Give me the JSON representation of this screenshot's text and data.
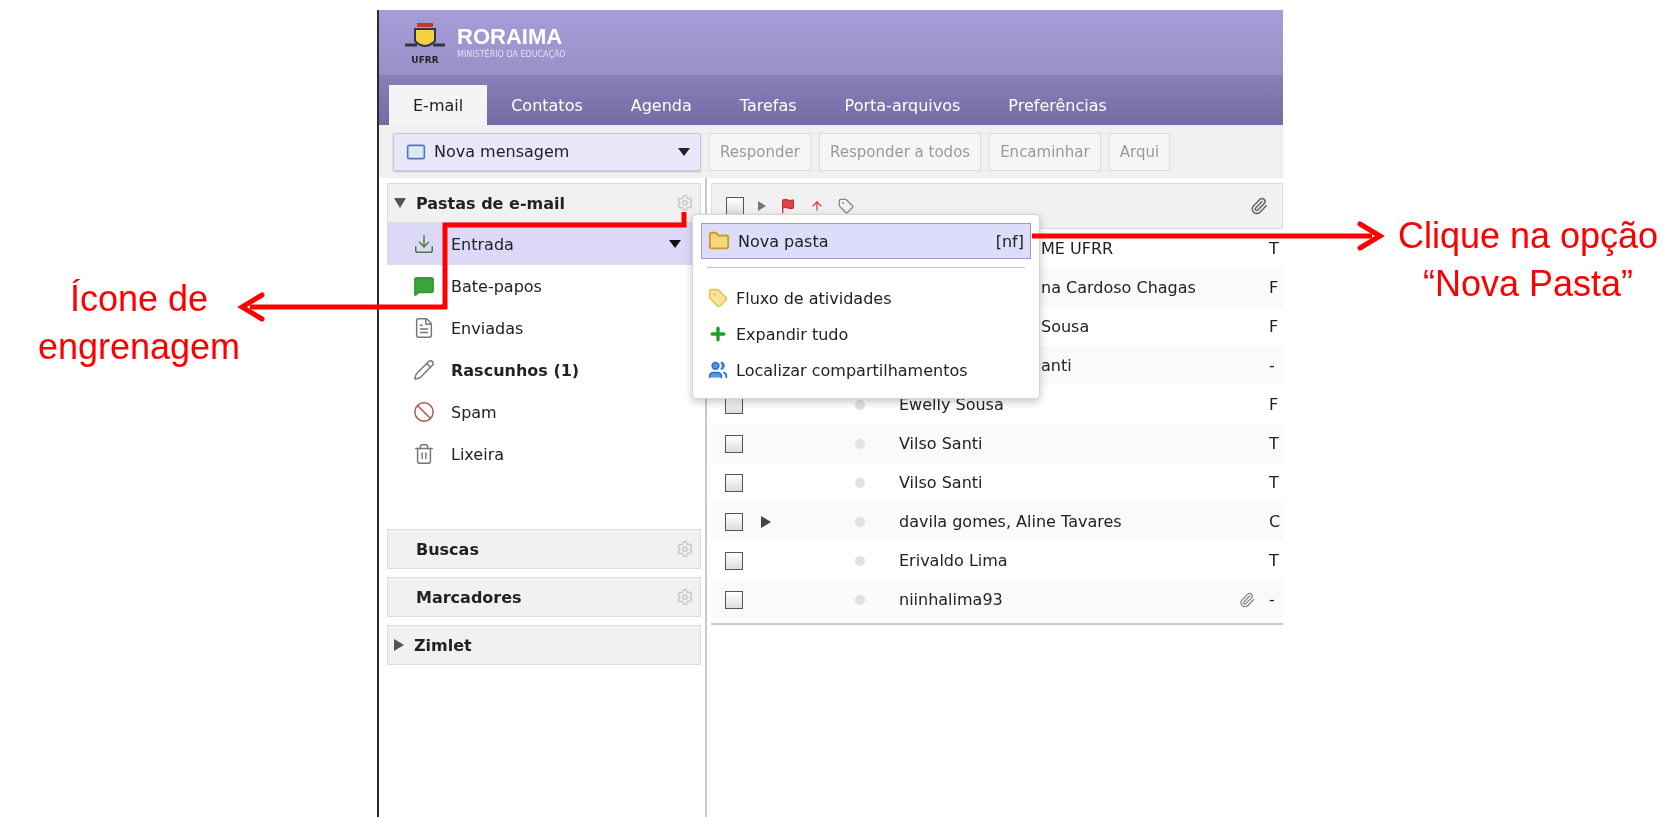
{
  "header": {
    "badge": "UFRR",
    "title": "RORAIMA",
    "subtitle": "MINISTÉRIO DA EDUCAÇÃO"
  },
  "tabs": [
    {
      "label": "E-mail",
      "selected": true
    },
    {
      "label": "Contatos",
      "selected": false
    },
    {
      "label": "Agenda",
      "selected": false
    },
    {
      "label": "Tarefas",
      "selected": false
    },
    {
      "label": "Porta-arquivos",
      "selected": false
    },
    {
      "label": "Preferências",
      "selected": false
    }
  ],
  "toolbar": {
    "new_button": "Nova mensagem",
    "buttons": [
      {
        "label": "Responder",
        "disabled": true
      },
      {
        "label": "Responder a todos",
        "disabled": true
      },
      {
        "label": "Encaminhar",
        "disabled": true
      },
      {
        "label": "Arqui",
        "disabled": true
      }
    ]
  },
  "sidebar": {
    "sections": [
      {
        "title": "Pastas de e-mail",
        "kind": "tree",
        "expanded": true,
        "gear": true,
        "items": [
          {
            "label": "Entrada",
            "kind": "inbox",
            "selected": true,
            "unread": false
          },
          {
            "label": "Bate-papos",
            "kind": "chats",
            "selected": false,
            "unread": false
          },
          {
            "label": "Enviadas",
            "kind": "sent",
            "selected": false,
            "unread": false
          },
          {
            "label": "Rascunhos (1)",
            "kind": "drafts",
            "selected": false,
            "unread": true
          },
          {
            "label": "Spam",
            "kind": "spam",
            "selected": false,
            "unread": false
          },
          {
            "label": "Lixeira",
            "kind": "trash",
            "selected": false,
            "unread": false
          }
        ]
      },
      {
        "title": "Buscas",
        "kind": "plain",
        "gear": true
      },
      {
        "title": "Marcadores",
        "kind": "plain",
        "gear": true
      },
      {
        "title": "Zimlet",
        "kind": "tree",
        "expanded": false,
        "gear": false
      }
    ]
  },
  "message_list": {
    "select_all_checked": false,
    "rows": [
      {
        "from": "ME UFRR",
        "column_2": "T",
        "covered": true,
        "thread": false,
        "attachment": false
      },
      {
        "from": "na Cardoso Chagas",
        "column_2": "F",
        "covered": true,
        "thread": false,
        "attachment": false
      },
      {
        "from": "Sousa",
        "column_2": "F",
        "covered": true,
        "thread": false,
        "attachment": false
      },
      {
        "from": "anti",
        "column_2": "-",
        "covered": true,
        "thread": false,
        "attachment": false
      },
      {
        "from": "Ewelly Sousa",
        "column_2": "F",
        "covered": false,
        "checked": false,
        "thread": false,
        "attachment": false
      },
      {
        "from": "Vilso Santi",
        "column_2": "T",
        "covered": false,
        "checked": false,
        "thread": false,
        "attachment": false
      },
      {
        "from": "Vilso Santi",
        "column_2": "T",
        "covered": false,
        "checked": false,
        "thread": false,
        "attachment": false
      },
      {
        "from": "davila gomes, Aline Tavares",
        "column_2": "C",
        "covered": false,
        "checked": false,
        "thread": true,
        "attachment": false
      },
      {
        "from": "Erivaldo Lima",
        "column_2": "T",
        "covered": false,
        "checked": false,
        "thread": false,
        "attachment": false
      },
      {
        "from": "niinhalima93",
        "column_2": "-",
        "covered": false,
        "checked": false,
        "thread": false,
        "attachment": true
      }
    ]
  },
  "context_menu": {
    "items": [
      {
        "kind": "new-folder",
        "label": "Nova pasta",
        "shortcut": "[nf]",
        "selected": true
      },
      {
        "kind": "separator"
      },
      {
        "kind": "activity",
        "label": "Fluxo de atividades",
        "selected": false
      },
      {
        "kind": "expand",
        "label": "Expandir tudo",
        "selected": false
      },
      {
        "kind": "shares",
        "label": "Localizar compartilhamentos",
        "selected": false
      }
    ]
  },
  "annotations": {
    "left": "Ícone de engrenagem",
    "right": "Clique na opção “Nova Pasta”"
  }
}
